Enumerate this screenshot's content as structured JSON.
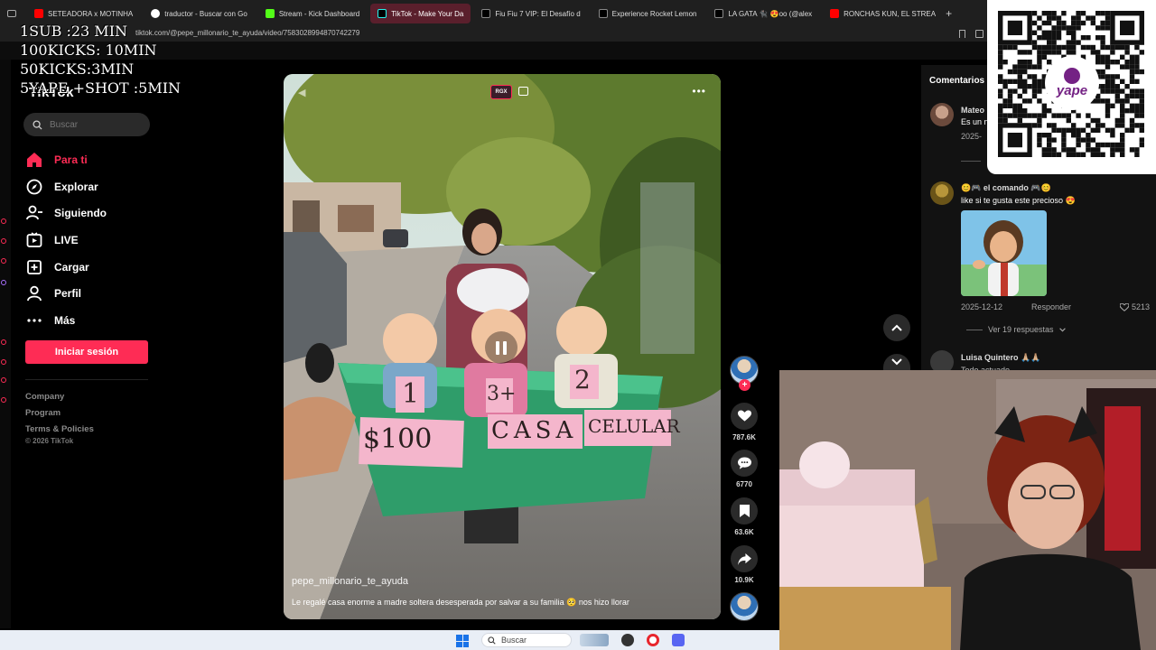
{
  "browser": {
    "tabs": [
      {
        "title": "SETEADORA x MOTINHA",
        "color": "#ff0000"
      },
      {
        "title": "traductor - Buscar con Go",
        "color": "#4285f4"
      },
      {
        "title": "Stream - Kick Dashboard",
        "color": "#53fc18"
      },
      {
        "title": "TikTok - Make Your Da",
        "color": "#ffffff",
        "active": true
      },
      {
        "title": "Fiu Fiu 7 VIP: El Desafío d",
        "color": "#ffffff"
      },
      {
        "title": "Experience Rocket Lemon",
        "color": "#ffffff"
      },
      {
        "title": "LA GATA 🐈‍⬛ 😍oo (@alex",
        "color": "#ffffff"
      },
      {
        "title": "RONCHAS KUN, EL STREA",
        "color": "#ff0000"
      }
    ],
    "new_tab": "+",
    "address": "tiktok.com/@pepe_millonario_te_ayuda/video/7583028994870742279"
  },
  "overlay": {
    "goals": [
      "1SUB :23 MIN",
      "100KICKS: 10MIN",
      "50KICKS:3MIN",
      "5YAPE +SHOT :5MIN"
    ]
  },
  "tiktok": {
    "logo": "TikTok",
    "search_placeholder": "Buscar",
    "nav": [
      {
        "label": "Para ti",
        "icon": "home-icon",
        "active": true
      },
      {
        "label": "Explorar",
        "icon": "compass-icon"
      },
      {
        "label": "Siguiendo",
        "icon": "following-icon"
      },
      {
        "label": "LIVE",
        "icon": "live-icon"
      },
      {
        "label": "Cargar",
        "icon": "upload-icon"
      },
      {
        "label": "Perfil",
        "icon": "profile-icon"
      },
      {
        "label": "Más",
        "icon": "more-icon"
      }
    ],
    "login": "Iniciar sesión",
    "footer_links": [
      "Company",
      "Program",
      "Terms & Policies"
    ],
    "copyright": "© 2026 TikTok"
  },
  "video": {
    "badge": "RGX",
    "author": "pepe_millonario_te_ayuda",
    "caption": "Le regalé casa enorme a madre soltera desesperada por salvar a su familia 🥺 nos hizo llorar",
    "sign_labels": [
      "1",
      "3+",
      "2",
      "$100",
      "CASA",
      "CELULAR"
    ]
  },
  "actions": {
    "likes": "787.6K",
    "comments": "6770",
    "saves": "63.6K",
    "shares": "10.9K"
  },
  "comments": {
    "title": "Comentarios",
    "items": [
      {
        "user": "Mateo",
        "text": "Es un n",
        "date": "2025-"
      },
      {
        "user": "😊🎮 el comando 🎮😊",
        "text": "like si te gusta este precioso 😍",
        "date": "2025-12-12",
        "reply": "Responder",
        "likes": "5213"
      },
      {
        "user": "Luisa Quintero 🙏🏼🙏🏼",
        "text": "Todo actuado"
      }
    ],
    "view_replies": "Ver 19 respuestas"
  },
  "qr": {
    "brand": "yape"
  },
  "taskbar": {
    "search_placeholder": "Buscar"
  }
}
